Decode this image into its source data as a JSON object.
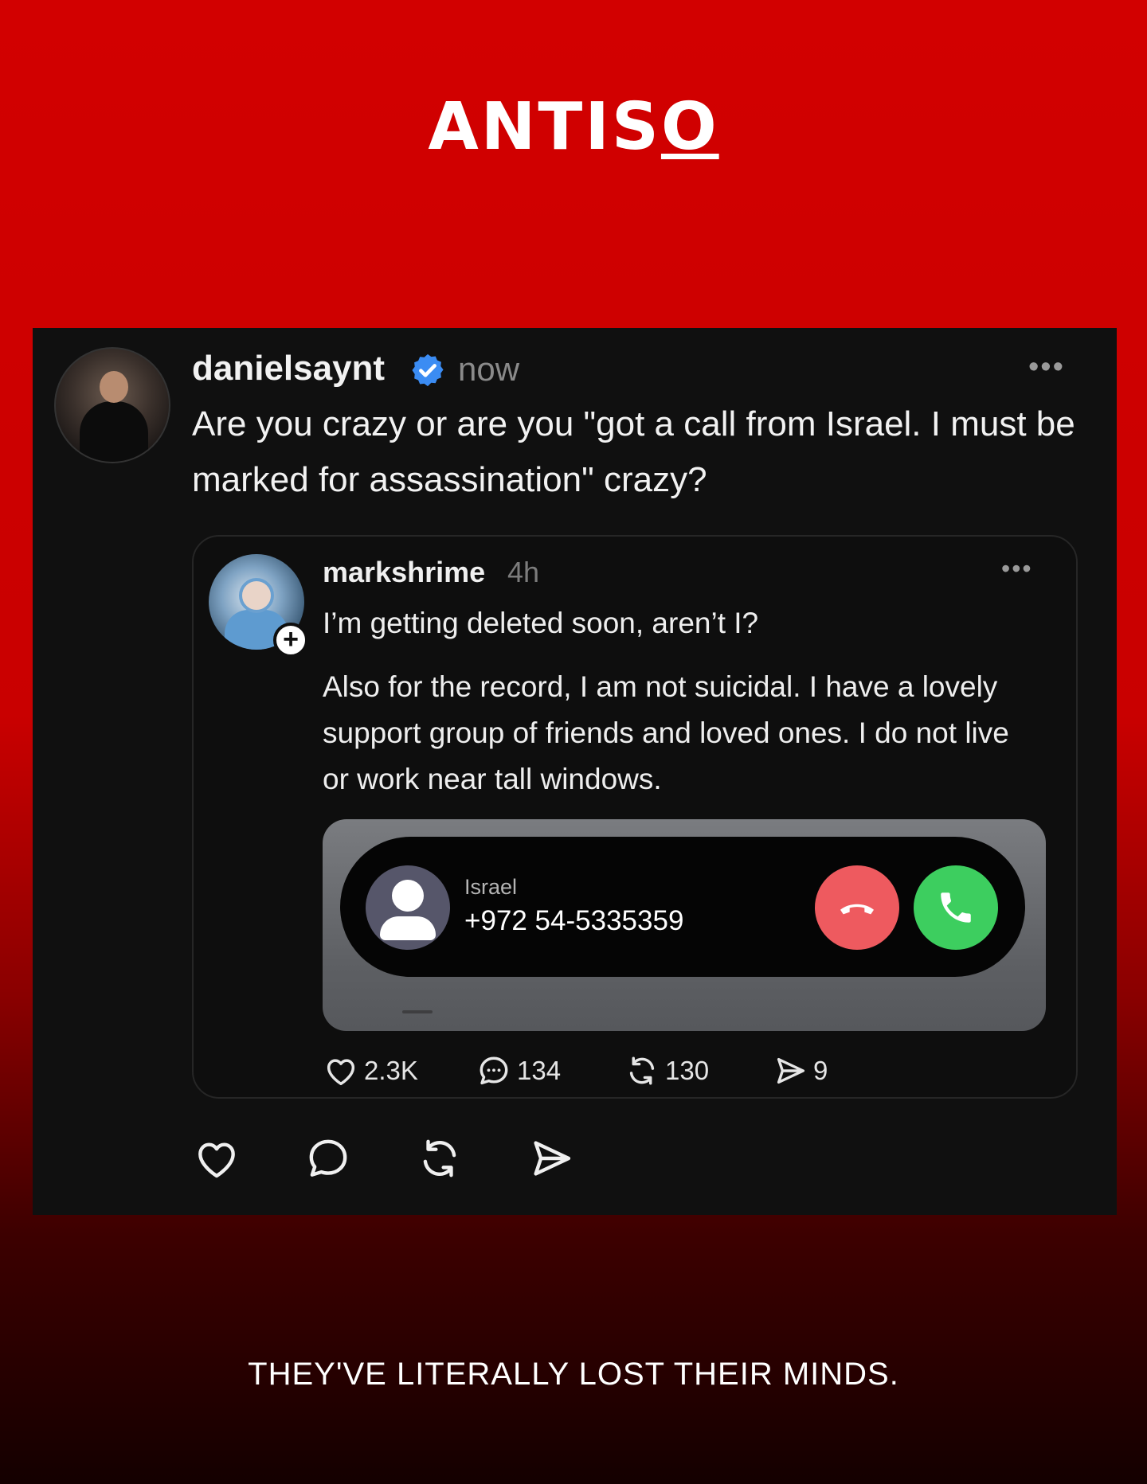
{
  "brand": {
    "prefix": "ANTIS",
    "underlined_letter": "O"
  },
  "post": {
    "username": "danielsaynt",
    "verified": true,
    "time": "now",
    "more_label": "•••",
    "text": "Are you crazy or are you \"got a call from Israel. I must be marked for assassination\" crazy?",
    "quote": {
      "username": "markshrime",
      "time": "4h",
      "more_label": "•••",
      "follow_label": "+",
      "text_line1": "I’m getting deleted soon, aren’t I?",
      "text_line2": "Also for the record, I am not suicidal. I have a lovely support group of friends and loved ones. I do not live or work near tall windows.",
      "call": {
        "caller_name": "Israel",
        "caller_number": "+972 54-5335359",
        "decline_color": "#ee5a5f",
        "accept_color": "#3dce5f"
      },
      "stats": {
        "likes": "2.3K",
        "comments": "134",
        "reposts": "130",
        "shares": "9"
      }
    },
    "actions": [
      "heart-icon",
      "comment-icon",
      "repost-icon",
      "share-icon"
    ]
  },
  "caption": "THEY'VE LITERALLY LOST THEIR MINDS.",
  "colors": {
    "background_top": "#d20000",
    "background_bottom": "#140000",
    "card": "#101010",
    "verified": "#3b8cf3"
  }
}
